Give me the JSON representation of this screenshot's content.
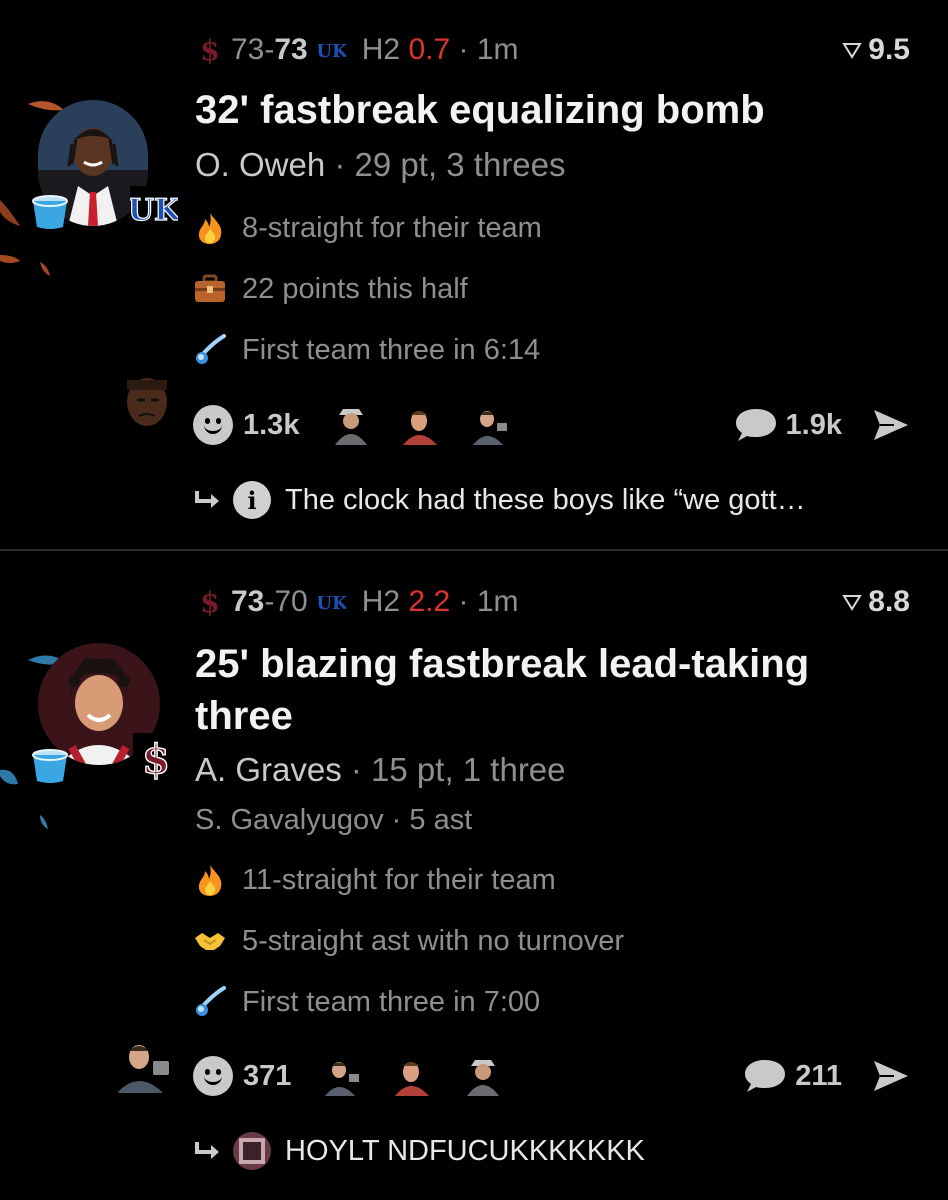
{
  "colors": {
    "background": "#000000",
    "accent_red": "#e0322f",
    "uk_blue": "#1e4fb8",
    "sc_garnet": "#7a1a2a",
    "muted": "#8e8e93"
  },
  "posts": [
    {
      "score_home": "73",
      "score_sep": "-",
      "score_away": "73",
      "period": "H2",
      "time_left": "0.7",
      "dot": "·",
      "age": "1m",
      "rating": "9.5",
      "title": "32' fastbreak equalizing bomb",
      "player_name": "O. Oweh",
      "player_sep": " · ",
      "player_stats": "29 pt, 3 threes",
      "stats": [
        {
          "icon": "fire-icon",
          "text": "8-straight for their team"
        },
        {
          "icon": "briefcase-icon",
          "text": "22 points this half"
        },
        {
          "icon": "comet-icon",
          "text": "First team three in 6:14"
        }
      ],
      "reactions_count": "1.3k",
      "comments_count": "1.9k",
      "reply_text": "The clock had these boys like “we gott…",
      "reply_info": "i"
    },
    {
      "score_home": "73",
      "score_sep": "-",
      "score_away": "70",
      "period": "H2",
      "time_left": "2.2",
      "dot": "·",
      "age": "1m",
      "rating": "8.8",
      "title": "25' blazing fastbreak lead-taking three",
      "player_name": "A. Graves",
      "player_sep": " · ",
      "player_stats": "15 pt, 1 three",
      "assist_name": "S. Gavalyugov",
      "assist_sep": " · ",
      "assist_stats": "5 ast",
      "stats": [
        {
          "icon": "fire-icon",
          "text": "11-straight for their team"
        },
        {
          "icon": "handshake-icon",
          "text": "5-straight ast with no turnover"
        },
        {
          "icon": "comet-icon",
          "text": "First team three in 7:00"
        }
      ],
      "reactions_count": "371",
      "comments_count": "211",
      "reply_text": "HOYLT NDFUCUKKKKKKK"
    }
  ]
}
